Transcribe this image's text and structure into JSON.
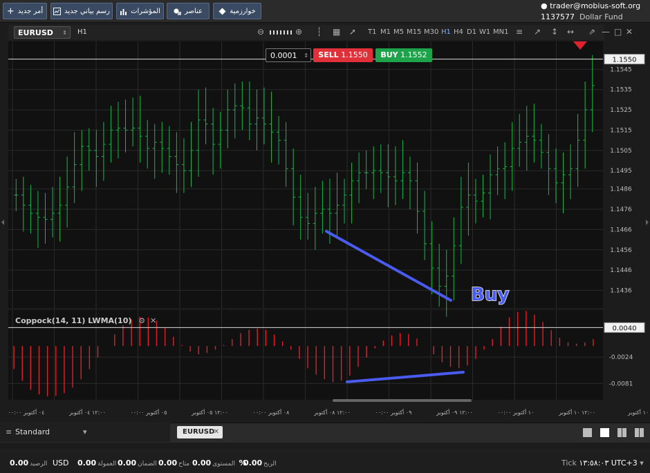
{
  "toolbar": {
    "new_order": "أمر جديد",
    "new_chart": "رسم بياني جديد",
    "indicators": "المؤشرات",
    "elements": "عناصر",
    "algorithms": "خوارزمية"
  },
  "account": {
    "email": "trader@mobius-soft.org",
    "account_id": "1137577",
    "account_name": "Dollar Fund"
  },
  "chart_toolbar": {
    "symbol": "EURUSD",
    "timeframe_label": "H1",
    "timeframes": [
      "T1",
      "M1",
      "M5",
      "M15",
      "M30",
      "H1",
      "H4",
      "D1",
      "W1",
      "MN1"
    ],
    "active_timeframe": "H1"
  },
  "trade": {
    "quantity": "0.0001",
    "sell_label": "SELL",
    "sell_price": "1.1550",
    "buy_label": "BUY",
    "buy_price": "1.1552"
  },
  "annotation_text": "Buy",
  "indicator": {
    "label": "Coppock(14, 11) LWMA(10)"
  },
  "chart_data": [
    {
      "type": "candlestick",
      "symbol": "EURUSD",
      "timeframe": "H1",
      "ylim": [
        1.1428,
        1.1556
      ],
      "yticks": [
        "1.1545",
        "1.1535",
        "1.1525",
        "1.1515",
        "1.1505",
        "1.1495",
        "1.1486",
        "1.1476",
        "1.1466",
        "1.1456",
        "1.1446",
        "1.1436"
      ],
      "current_price": "1.1550",
      "bar_color": "#18b84a",
      "closes": [
        1.1483,
        1.1478,
        1.1474,
        1.1472,
        1.1471,
        1.1474,
        1.1478,
        1.1487,
        1.1498,
        1.1507,
        1.1505,
        1.1502,
        1.1508,
        1.1515,
        1.1516,
        1.1515,
        1.1516,
        1.1512,
        1.1506,
        1.1509,
        1.1506,
        1.1502,
        1.1498,
        1.1495,
        1.1505,
        1.152,
        1.1518,
        1.1508,
        1.1515,
        1.1525,
        1.1527,
        1.1526,
        1.1518,
        1.1521,
        1.1518,
        1.1514,
        1.151,
        1.1496,
        1.1482,
        1.1472,
        1.1469,
        1.1474,
        1.1476,
        1.1474,
        1.1478,
        1.1483,
        1.149,
        1.1494,
        1.1494,
        1.1495,
        1.1494,
        1.1492,
        1.149,
        1.1494,
        1.149,
        1.1475,
        1.1459,
        1.1447,
        1.1438,
        1.1443,
        1.1458,
        1.1477,
        1.1483,
        1.148,
        1.1484,
        1.1493,
        1.1496,
        1.1497,
        1.1506,
        1.1509,
        1.1512,
        1.151,
        1.1504,
        1.1496,
        1.1489,
        1.1493,
        1.1496,
        1.151,
        1.1525,
        1.1537
      ]
    },
    {
      "type": "histogram",
      "name": "Coppock(14, 11) LWMA(10)",
      "ylim": [
        -0.0112,
        0.0072
      ],
      "yticks": [
        "-0.0024",
        "-0.0081"
      ],
      "current_value": "0.0040",
      "bar_color": "#e0202a",
      "values": [
        -0.005,
        -0.0075,
        -0.0095,
        -0.0105,
        -0.0109,
        -0.0108,
        -0.0102,
        -0.009,
        -0.0072,
        -0.005,
        -0.0025,
        0,
        0.0025,
        0.0045,
        0.0058,
        0.0063,
        0.0062,
        0.0055,
        0.004,
        0.002,
        0.0002,
        -0.0012,
        -0.0018,
        -0.0015,
        -0.0008,
        0.0002,
        0.0015,
        0.0028,
        0.0035,
        0.0038,
        0.0035,
        0.0025,
        0.001,
        -0.0008,
        -0.0028,
        -0.0048,
        -0.0062,
        -0.0072,
        -0.0078,
        -0.0075,
        -0.0064,
        -0.0045,
        -0.0025,
        -0.0005,
        0.0012,
        0.0023,
        0.0028,
        0.0026,
        0.0016,
        0.0,
        -0.0018,
        -0.0035,
        -0.0045,
        -0.0048,
        -0.0042,
        -0.0028,
        -0.0008,
        0.0015,
        0.0042,
        0.0062,
        0.0074,
        0.0076,
        0.0068,
        0.0052,
        0.0034,
        0.0018,
        0.0008,
        0.0005,
        0.0008,
        0.0015
      ]
    }
  ],
  "xaxis_labels": [
    "٠٤ أكتوبر ٠٠:٠٠",
    "١٢:٠٠ ٠٤ أكتوبر",
    "٠٥ أكتوبر ٠٠:٠٠",
    "١٢:٠٠ ٠٥ أكتوبر",
    "٠٨ أكتوبر ٠٠:٠٠",
    "١٢:٠٠ ٠٨ أكتوبر",
    "٠٩ أكتوبر ٠٠:٠٠",
    "١٢:٠٠ ٠٩ أكتوبر",
    "١٠ أكتوبر ٠٠:٠٠",
    "١٢:٠٠ ١٠ أكتوبر",
    "١٠ أكتوبر"
  ],
  "bottom": {
    "layout_name": "Standard",
    "tab": "EURUSD"
  },
  "status": {
    "balance": "0.00",
    "balance_label": "الرصيد",
    "currency": "USD",
    "equity": "0.00",
    "equity_label": "العمولة",
    "margin": "0.00",
    "margin_label": "الضمان",
    "free": "0.00",
    "free_label": "متاح",
    "level": "0.00",
    "level_label": "المستوى",
    "pct": "%",
    "profit": "0.00",
    "profit_label": "الربح",
    "tick_label": "Tick",
    "time": "١٣:٥٨:٠٣",
    "tz": "UTC+3"
  },
  "colors": {
    "accent": "#3a4a63",
    "sell": "#e0303a",
    "buy": "#1ea34a",
    "trend_line": "#4a5cf0"
  }
}
